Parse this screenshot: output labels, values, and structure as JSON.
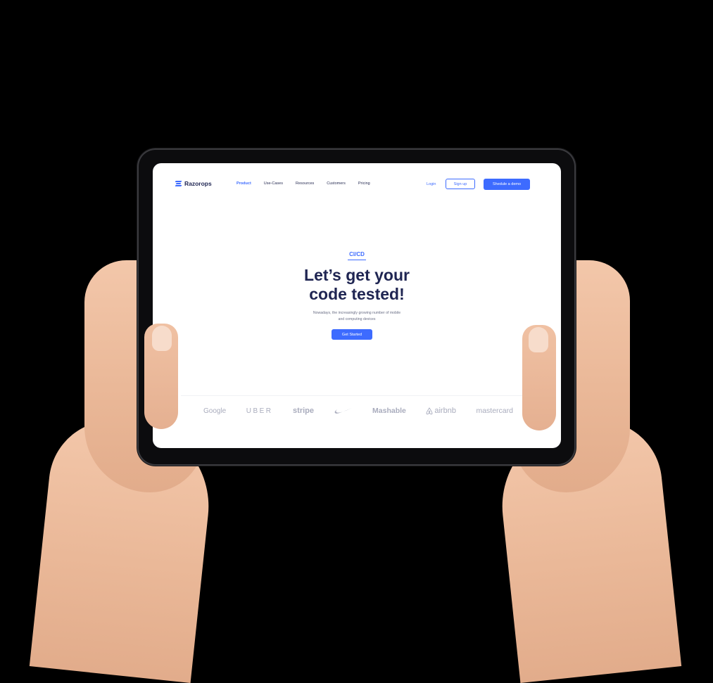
{
  "nav": {
    "logo_text": "Razorops",
    "links": [
      "Product",
      "Use-Cases",
      "Resources",
      "Customers",
      "Pricing"
    ],
    "active_link": "Product",
    "login_label": "Login",
    "signup_label": "Sign up",
    "demo_label": "Shedule a demo"
  },
  "hero": {
    "eyebrow": "CI/CD",
    "headline_line1": "Let’s get your",
    "headline_line2": "code tested!",
    "sub_line1": "Nowadays, the increasingly growing number of mobile",
    "sub_line2": "and computing devices",
    "cta_label": "Get Started"
  },
  "brands": {
    "google": "Google",
    "uber": "UBER",
    "stripe": "stripe",
    "nike_icon": "nike-swoosh-icon",
    "mashable": "Mashable",
    "airbnb": "airbnb",
    "mastercard": "mastercard"
  },
  "colors": {
    "accent": "#3d6bff",
    "heading": "#1f2552",
    "brand_gray": "#a9acbd",
    "background": "#000000"
  }
}
